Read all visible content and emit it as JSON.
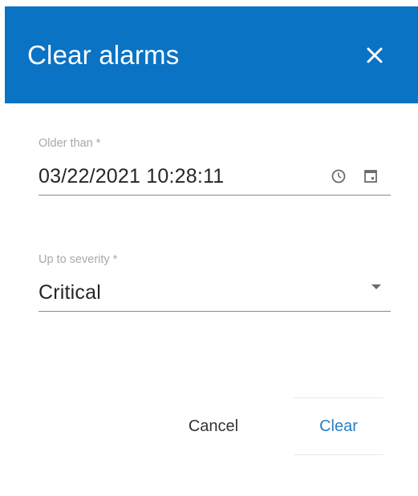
{
  "dialog": {
    "title": "Clear alarms",
    "close_icon": "close-icon"
  },
  "form": {
    "older_than": {
      "label": "Older than *",
      "value": "03/22/2021 10:28:11",
      "icons": [
        "clock-icon",
        "calendar-icon"
      ]
    },
    "severity": {
      "label": "Up to severity *",
      "value": "Critical",
      "icon": "caret-down-icon"
    }
  },
  "actions": {
    "cancel_label": "Cancel",
    "clear_label": "Clear"
  },
  "colors": {
    "header_bg": "#0a73c4",
    "primary_text": "#2a7fc4"
  }
}
